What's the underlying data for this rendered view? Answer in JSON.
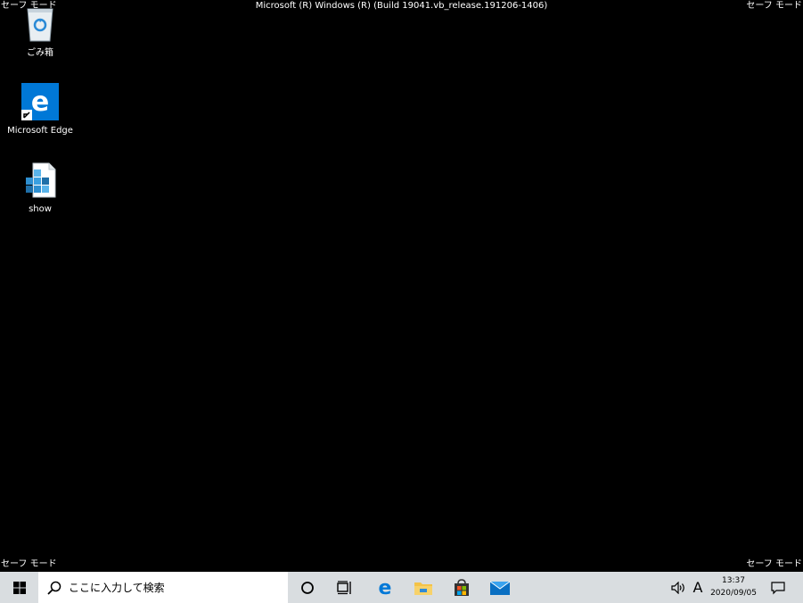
{
  "safe_mode_label": "セーフ モード",
  "build_info": "Microsoft (R) Windows (R) (Build 19041.vb_release.191206-1406)",
  "desktop_icons": [
    {
      "label": "ごみ箱",
      "icon": "recycle-bin-icon"
    },
    {
      "label": "Microsoft Edge",
      "icon": "edge-icon"
    },
    {
      "label": "show",
      "icon": "registry-file-icon"
    }
  ],
  "taskbar": {
    "search_placeholder": "ここに入力して検索",
    "pinned": [
      "cortana-icon",
      "task-view-icon",
      "edge-icon",
      "file-explorer-icon",
      "store-icon",
      "mail-icon"
    ],
    "ime_indicator": "A",
    "time": "13:37",
    "date": "2020/09/05"
  },
  "colors": {
    "desktop_bg": "#000000",
    "taskbar_bg": "#d9dde0",
    "accent": "#0078d7"
  }
}
